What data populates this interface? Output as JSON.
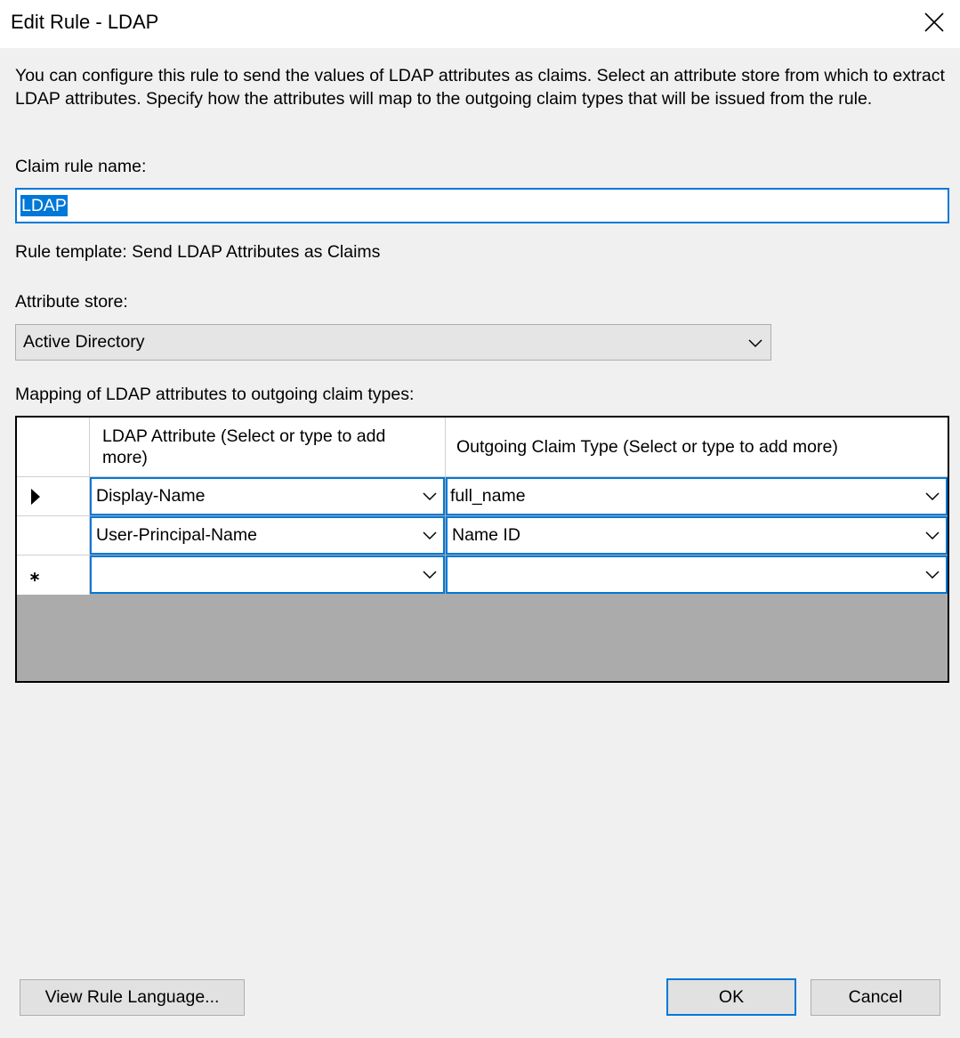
{
  "window": {
    "title": "Edit Rule - LDAP",
    "close_icon": "close-icon"
  },
  "description": "You can configure this rule to send the values of LDAP attributes as claims. Select an attribute store from which to extract LDAP attributes. Specify how the attributes will map to the outgoing claim types that will be issued from the rule.",
  "claim_rule_name": {
    "label": "Claim rule name:",
    "value": "LDAP"
  },
  "rule_template": "Rule template: Send LDAP Attributes as Claims",
  "attribute_store": {
    "label": "Attribute store:",
    "selected": "Active Directory"
  },
  "mapping": {
    "label": "Mapping of LDAP attributes to outgoing claim types:",
    "columns": [
      "LDAP Attribute (Select or type to add more)",
      "Outgoing Claim Type (Select or type to add more)"
    ],
    "rows": [
      {
        "indicator": "current-row-arrow-icon",
        "ldap_attribute": "Display-Name",
        "claim_type": "full_name"
      },
      {
        "indicator": "",
        "ldap_attribute": "User-Principal-Name",
        "claim_type": "Name ID"
      },
      {
        "indicator": "new-row-asterisk-icon",
        "ldap_attribute": "",
        "claim_type": ""
      }
    ]
  },
  "buttons": {
    "view_rule_language": "View Rule Language...",
    "ok": "OK",
    "cancel": "Cancel"
  },
  "colors": {
    "accent": "#0078d7",
    "background": "#f0f0f0",
    "grid_empty": "#ababab"
  }
}
